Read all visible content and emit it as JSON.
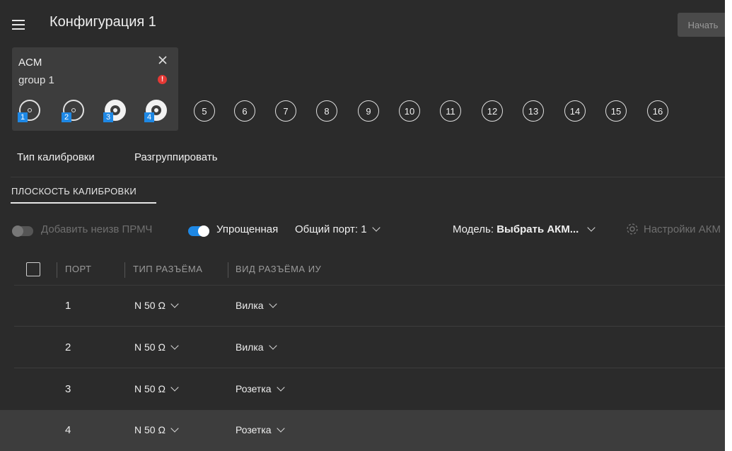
{
  "header": {
    "title": "Конфигурация 1",
    "start_label": "Начать"
  },
  "group": {
    "name": "ACM",
    "subtitle": "group 1",
    "warning_glyph": "!",
    "ports": [
      {
        "num": "1",
        "style": "outline"
      },
      {
        "num": "2",
        "style": "outline"
      },
      {
        "num": "3",
        "style": "filled"
      },
      {
        "num": "4",
        "style": "filled"
      }
    ]
  },
  "available_ports": [
    "5",
    "6",
    "7",
    "8",
    "9",
    "10",
    "11",
    "12",
    "13",
    "14",
    "15",
    "16"
  ],
  "tabs": {
    "cal_type": "Тип калибровки",
    "ungroup": "Разгруппировать"
  },
  "plane_tab": "ПЛОСКОСТЬ КАЛИБРОВКИ",
  "options": {
    "add_unknown_label": "Добавить неизв ПРМЧ",
    "add_unknown_on": false,
    "simplified_label": "Упрощенная",
    "simplified_on": true,
    "common_port_label": "Общий порт: 1",
    "model_prefix": "Модель:",
    "model_value": "Выбрать АКМ...",
    "acm_settings_label": "Настройки АКМ"
  },
  "table": {
    "headers": {
      "port": "ПОРТ",
      "connector_type": "ТИП РАЗЪЁМА",
      "kind": "ВИД РАЗЪЁМА ИУ"
    },
    "rows": [
      {
        "port": "1",
        "type": "N 50 Ω",
        "kind": "Вилка"
      },
      {
        "port": "2",
        "type": "N 50 Ω",
        "kind": "Вилка"
      },
      {
        "port": "3",
        "type": "N 50 Ω",
        "kind": "Розетка"
      },
      {
        "port": "4",
        "type": "N 50 Ω",
        "kind": "Розетка"
      }
    ]
  },
  "colors": {
    "background": "#2b2b2b",
    "card": "#3d3d3d",
    "accent": "#1e88e5",
    "warning": "#e53935"
  },
  "icons": [
    "menu-icon",
    "close-icon",
    "warning-icon",
    "gear-icon",
    "chevron-down-icon",
    "port-connector-icon"
  ]
}
